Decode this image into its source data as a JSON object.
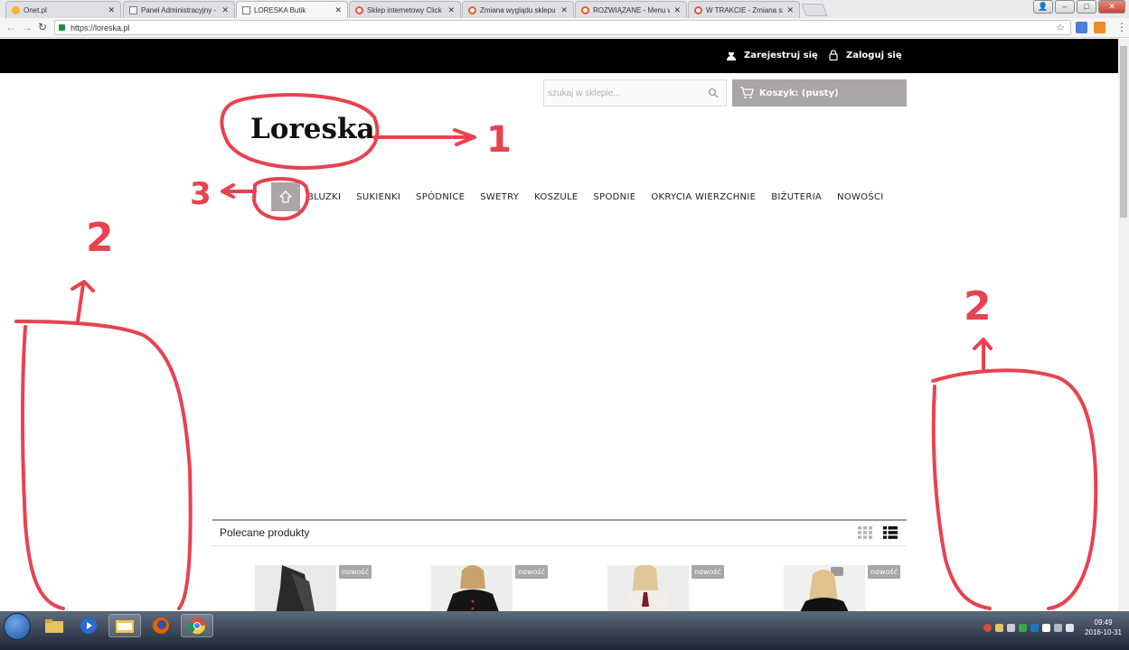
{
  "browser": {
    "tabs": [
      {
        "label": "Onet.pl",
        "icon": "onet-icon",
        "active": false
      },
      {
        "label": "Panel Administracyjny - ",
        "icon": "page-icon",
        "active": false
      },
      {
        "label": "LORESKA Butik",
        "icon": "page-icon",
        "active": true
      },
      {
        "label": "Sklep internetowy Click ",
        "icon": "help-icon",
        "active": false
      },
      {
        "label": "Zmiana wyglądu sklepu ",
        "icon": "help-icon",
        "active": false
      },
      {
        "label": "ROZWIĄZANE - Menu w",
        "icon": "help-icon",
        "active": false
      },
      {
        "label": "W TRAKCIE - Zmiana sz",
        "icon": "help-icon",
        "active": false
      }
    ],
    "url": "https://loreska.pl"
  },
  "site": {
    "register_label": "Zarejestruj się",
    "login_label": "Zaloguj się",
    "search_placeholder": "szukaj w sklepie...",
    "cart_label": "Koszyk: (pusty)",
    "logo_text": "Loreska",
    "menu": [
      "BLUZKI",
      "SUKIENKI",
      "SPÓDNICE",
      "SWETRY",
      "KOSZULE",
      "SPODNIE",
      "OKRYCIA WIERZCHNIE",
      "BIŻUTERIA",
      "NOWOŚCI"
    ],
    "featured_title": "Polecane produkty",
    "products": [
      {
        "badge": "nowość"
      },
      {
        "badge": "nowość"
      },
      {
        "badge": "nowość"
      },
      {
        "badge": "nowość"
      }
    ]
  },
  "annotations": {
    "labels": [
      "1",
      "2",
      "2",
      "3"
    ],
    "color": "#e8424f"
  },
  "taskbar": {
    "time": "09:49",
    "date": "2016-10-31"
  }
}
